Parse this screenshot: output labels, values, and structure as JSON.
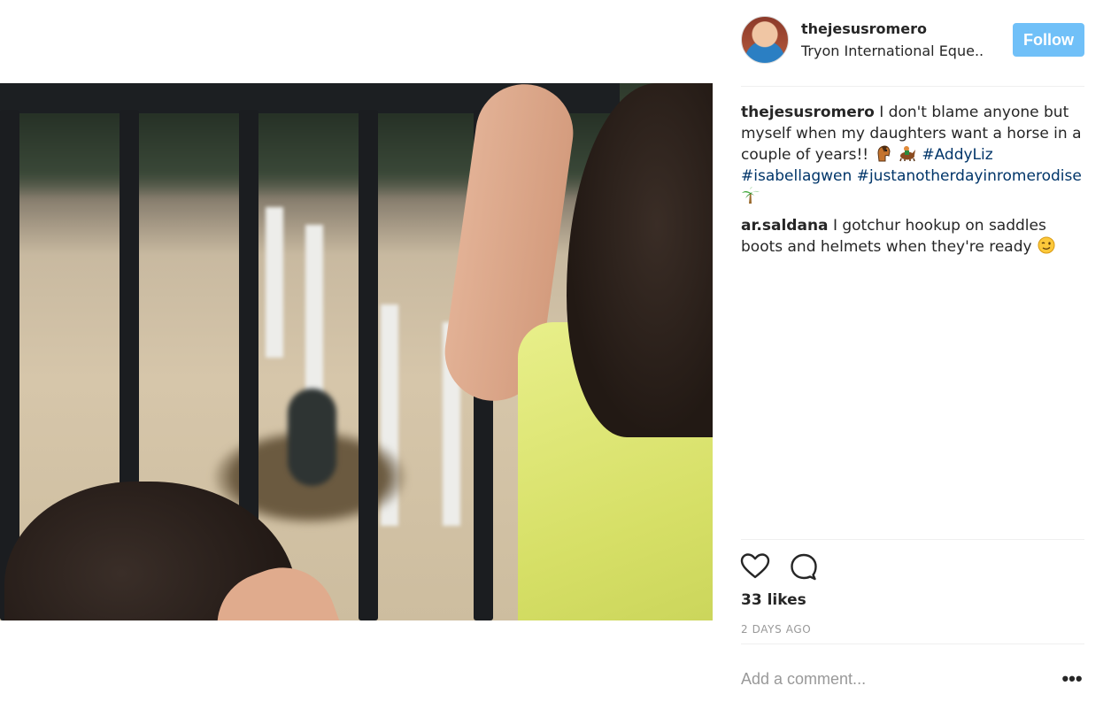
{
  "post": {
    "photo_icon": "photo-image",
    "owner": {
      "username": "thejesusromero",
      "location": "Tryon International Eque..",
      "follow_label": "Follow"
    },
    "caption": {
      "username": "thejesusromero",
      "text": "I don't blame anyone but myself when my daughters want a horse in a couple of years!!",
      "emojis": [
        "horse-face-emoji",
        "horse-racing-emoji",
        "palm-tree-emoji"
      ],
      "hashtags": [
        "#AddyLiz",
        "#isabellagwen",
        "#justanotherdayinromerodise"
      ]
    },
    "comments": [
      {
        "username": "ar.saldana",
        "text": "I gotchur hookup on saddles boots and helmets when they're ready",
        "emoji": "winking-face-emoji"
      }
    ],
    "likes_text": "33 likes",
    "time_text": "2 days ago",
    "add_comment_placeholder": "Add a comment...",
    "more_label": "•••"
  },
  "colors": {
    "follow_button": "#70c0f8",
    "hashtag": "#003569",
    "muted": "#999999",
    "text": "#262626"
  }
}
